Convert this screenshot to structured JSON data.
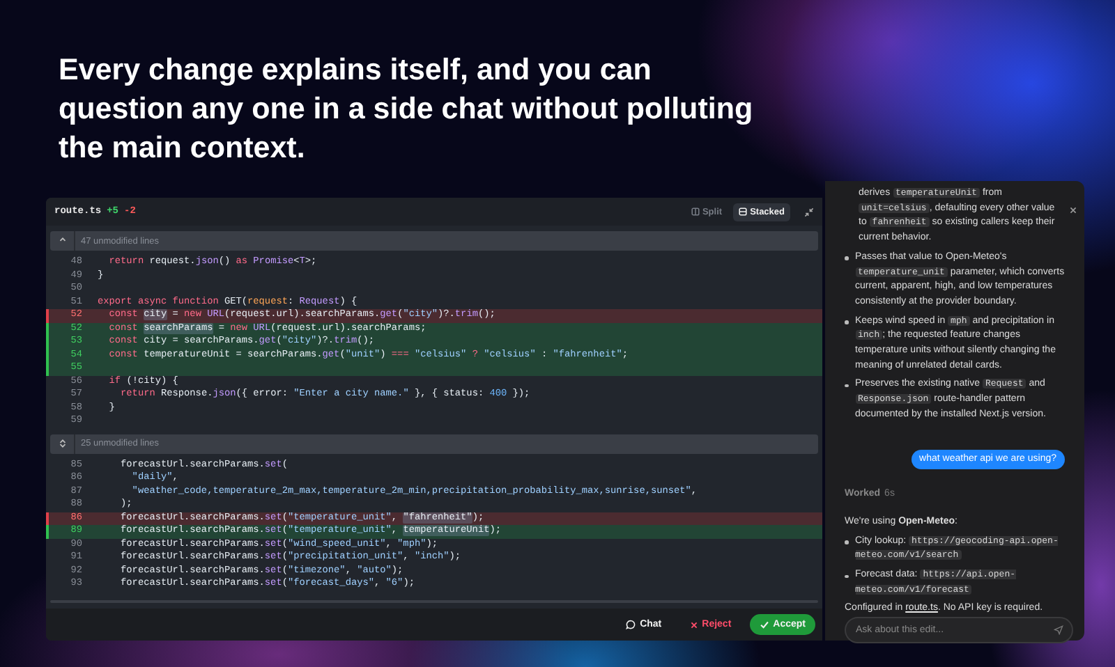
{
  "headline": "Every change explains itself, and you can question any one in a side chat without polluting the main context.",
  "editor": {
    "file": "route.ts",
    "added": "+5",
    "removed": "-2",
    "view_options": [
      {
        "label": "Split",
        "selected": false,
        "kind": "split"
      },
      {
        "label": "Stacked",
        "selected": true,
        "kind": "stacked"
      }
    ],
    "hunks": [
      {
        "collapsed": "47 unmodified lines",
        "lines": [
          {
            "number": "48",
            "kind": "context",
            "tokens": [
              {
                "text": "  return ",
                "kind": "keyword"
              },
              {
                "text": "request.",
                "kind": "plain"
              },
              {
                "text": "json",
                "kind": "function"
              },
              {
                "text": "() ",
                "kind": "plain"
              },
              {
                "text": "as ",
                "kind": "keyword"
              },
              {
                "text": "Promise",
                "kind": "type"
              },
              {
                "text": "<",
                "kind": "plain"
              },
              {
                "text": "T",
                "kind": "type"
              },
              {
                "text": ">;",
                "kind": "plain"
              }
            ]
          },
          {
            "number": "49",
            "kind": "context",
            "tokens": [
              {
                "text": "}",
                "kind": "plain"
              }
            ]
          },
          {
            "number": "50",
            "kind": "context"
          },
          {
            "number": "51",
            "kind": "context",
            "tokens": [
              {
                "text": "export async function ",
                "kind": "keyword"
              },
              {
                "text": "GET(",
                "kind": "plain"
              },
              {
                "text": "request",
                "kind": "param"
              },
              {
                "text": ": ",
                "kind": "plain"
              },
              {
                "text": "Request",
                "kind": "type"
              },
              {
                "text": ") {",
                "kind": "plain"
              }
            ]
          },
          {
            "number": "52",
            "kind": "removed",
            "tokens": [
              {
                "text": "  const ",
                "kind": "keyword"
              },
              {
                "text": "city",
                "kind": "highlight"
              },
              {
                "text": " = ",
                "kind": "plain"
              },
              {
                "text": "new ",
                "kind": "keyword"
              },
              {
                "text": "URL",
                "kind": "function"
              },
              {
                "text": "(request.url).searchParams.",
                "kind": "plain"
              },
              {
                "text": "get",
                "kind": "function"
              },
              {
                "text": "(",
                "kind": "plain"
              },
              {
                "text": "\"city\"",
                "kind": "string"
              },
              {
                "text": ")?.",
                "kind": "plain"
              },
              {
                "text": "trim",
                "kind": "function"
              },
              {
                "text": "();",
                "kind": "plain"
              }
            ]
          },
          {
            "number": "52",
            "kind": "added",
            "tokens": [
              {
                "text": "  const ",
                "kind": "keyword"
              },
              {
                "text": "searchParams",
                "kind": "highlight"
              },
              {
                "text": " = ",
                "kind": "plain"
              },
              {
                "text": "new ",
                "kind": "keyword"
              },
              {
                "text": "URL",
                "kind": "function"
              },
              {
                "text": "(request.url).searchParams;",
                "kind": "plain"
              }
            ]
          },
          {
            "number": "53",
            "kind": "added",
            "tokens": [
              {
                "text": "  const ",
                "kind": "keyword"
              },
              {
                "text": "city = searchParams.",
                "kind": "plain"
              },
              {
                "text": "get",
                "kind": "function"
              },
              {
                "text": "(",
                "kind": "plain"
              },
              {
                "text": "\"city\"",
                "kind": "string"
              },
              {
                "text": ")?.",
                "kind": "plain"
              },
              {
                "text": "trim",
                "kind": "function"
              },
              {
                "text": "();",
                "kind": "plain"
              }
            ]
          },
          {
            "number": "54",
            "kind": "added",
            "tokens": [
              {
                "text": "  const ",
                "kind": "keyword"
              },
              {
                "text": "temperatureUnit = searchParams.",
                "kind": "plain"
              },
              {
                "text": "get",
                "kind": "function"
              },
              {
                "text": "(",
                "kind": "plain"
              },
              {
                "text": "\"unit\"",
                "kind": "string"
              },
              {
                "text": ") ",
                "kind": "plain"
              },
              {
                "text": "=== ",
                "kind": "keyword"
              },
              {
                "text": "\"celsius\" ",
                "kind": "string"
              },
              {
                "text": "? ",
                "kind": "keyword"
              },
              {
                "text": "\"celsius\"",
                "kind": "string"
              },
              {
                "text": " : ",
                "kind": "plain"
              },
              {
                "text": "\"fahrenheit\"",
                "kind": "string"
              },
              {
                "text": ";",
                "kind": "plain"
              }
            ]
          },
          {
            "number": "55",
            "kind": "added"
          },
          {
            "number": "56",
            "kind": "context",
            "tokens": [
              {
                "text": "  if ",
                "kind": "keyword"
              },
              {
                "text": "(!city) {",
                "kind": "plain"
              }
            ]
          },
          {
            "number": "57",
            "kind": "context",
            "tokens": [
              {
                "text": "    return ",
                "kind": "keyword"
              },
              {
                "text": "Response.",
                "kind": "plain"
              },
              {
                "text": "json",
                "kind": "function"
              },
              {
                "text": "({ error: ",
                "kind": "plain"
              },
              {
                "text": "\"Enter a city name.\"",
                "kind": "string"
              },
              {
                "text": " }, { status: ",
                "kind": "plain"
              },
              {
                "text": "400",
                "kind": "number"
              },
              {
                "text": " });",
                "kind": "plain"
              }
            ]
          },
          {
            "number": "58",
            "kind": "context",
            "tokens": [
              {
                "text": "  }",
                "kind": "plain"
              }
            ]
          },
          {
            "number": "59",
            "kind": "context"
          }
        ]
      },
      {
        "collapsed": "25 unmodified lines",
        "lines": [
          {
            "number": "85",
            "kind": "context",
            "tokens": [
              {
                "text": "    forecastUrl.searchParams.",
                "kind": "plain"
              },
              {
                "text": "set",
                "kind": "function"
              },
              {
                "text": "(",
                "kind": "plain"
              }
            ]
          },
          {
            "number": "86",
            "kind": "context",
            "tokens": [
              {
                "text": "      \"daily\"",
                "kind": "string"
              },
              {
                "text": ",",
                "kind": "plain"
              }
            ]
          },
          {
            "number": "87",
            "kind": "context",
            "tokens": [
              {
                "text": "      \"weather_code,temperature_2m_max,temperature_2m_min,precipitation_probability_max,sunrise,sunset\"",
                "kind": "string"
              },
              {
                "text": ",",
                "kind": "plain"
              }
            ]
          },
          {
            "number": "88",
            "kind": "context",
            "tokens": [
              {
                "text": "    );",
                "kind": "plain"
              }
            ]
          },
          {
            "number": "86",
            "kind": "removed",
            "tokens": [
              {
                "text": "    forecastUrl.searchParams.",
                "kind": "plain"
              },
              {
                "text": "set",
                "kind": "function"
              },
              {
                "text": "(",
                "kind": "plain"
              },
              {
                "text": "\"temperature_unit\"",
                "kind": "string"
              },
              {
                "text": ", ",
                "kind": "plain"
              },
              {
                "text": "\"fahrenheit\"",
                "kind": "highlight"
              },
              {
                "text": ");",
                "kind": "plain"
              }
            ]
          },
          {
            "number": "89",
            "kind": "added",
            "tokens": [
              {
                "text": "    forecastUrl.searchParams.",
                "kind": "plain"
              },
              {
                "text": "set",
                "kind": "function"
              },
              {
                "text": "(",
                "kind": "plain"
              },
              {
                "text": "\"temperature_unit\"",
                "kind": "string"
              },
              {
                "text": ", ",
                "kind": "plain"
              },
              {
                "text": "temperatureUnit",
                "kind": "highlight"
              },
              {
                "text": ");",
                "kind": "plain"
              }
            ]
          },
          {
            "number": "90",
            "kind": "context",
            "tokens": [
              {
                "text": "    forecastUrl.searchParams.",
                "kind": "plain"
              },
              {
                "text": "set",
                "kind": "function"
              },
              {
                "text": "(",
                "kind": "plain"
              },
              {
                "text": "\"wind_speed_unit\"",
                "kind": "string"
              },
              {
                "text": ", ",
                "kind": "plain"
              },
              {
                "text": "\"mph\"",
                "kind": "string"
              },
              {
                "text": ");",
                "kind": "plain"
              }
            ]
          },
          {
            "number": "91",
            "kind": "context",
            "tokens": [
              {
                "text": "    forecastUrl.searchParams.",
                "kind": "plain"
              },
              {
                "text": "set",
                "kind": "function"
              },
              {
                "text": "(",
                "kind": "plain"
              },
              {
                "text": "\"precipitation_unit\"",
                "kind": "string"
              },
              {
                "text": ", ",
                "kind": "plain"
              },
              {
                "text": "\"inch\"",
                "kind": "string"
              },
              {
                "text": ");",
                "kind": "plain"
              }
            ]
          },
          {
            "number": "92",
            "kind": "context",
            "tokens": [
              {
                "text": "    forecastUrl.searchParams.",
                "kind": "plain"
              },
              {
                "text": "set",
                "kind": "function"
              },
              {
                "text": "(",
                "kind": "plain"
              },
              {
                "text": "\"timezone\"",
                "kind": "string"
              },
              {
                "text": ", ",
                "kind": "plain"
              },
              {
                "text": "\"auto\"",
                "kind": "string"
              },
              {
                "text": ");",
                "kind": "plain"
              }
            ]
          },
          {
            "number": "93",
            "kind": "context",
            "tokens": [
              {
                "text": "    forecastUrl.searchParams.",
                "kind": "plain"
              },
              {
                "text": "set",
                "kind": "function"
              },
              {
                "text": "(",
                "kind": "plain"
              },
              {
                "text": "\"forecast_days\"",
                "kind": "string"
              },
              {
                "text": ", ",
                "kind": "plain"
              },
              {
                "text": "\"6\"",
                "kind": "string"
              },
              {
                "text": ");",
                "kind": "plain"
              }
            ]
          }
        ]
      }
    ],
    "actions": [
      {
        "label": "Chat",
        "kind": "chat"
      },
      {
        "label": "Reject",
        "kind": "reject"
      },
      {
        "label": "Accept",
        "kind": "accept"
      }
    ]
  },
  "chat": {
    "intro": [
      {
        "text": "derives ",
        "kind": "text"
      },
      {
        "text": "temperatureUnit",
        "kind": "code"
      },
      {
        "text": " from ",
        "kind": "text"
      },
      {
        "text": "unit=celsius",
        "kind": "code"
      },
      {
        "text": ", defaulting every other value to ",
        "kind": "text"
      },
      {
        "text": "fahrenheit",
        "kind": "code"
      },
      {
        "text": " so existing callers keep their current behavior.",
        "kind": "text"
      }
    ],
    "bullets": [
      [
        {
          "text": "Passes that value to Open-Meteo's ",
          "kind": "text"
        },
        {
          "text": "temperature_unit",
          "kind": "code"
        },
        {
          "text": " parameter, which converts current, apparent, high, and low temperatures consistently at the provider boundary.",
          "kind": "text"
        }
      ],
      [
        {
          "text": "Keeps wind speed in ",
          "kind": "text"
        },
        {
          "text": "mph",
          "kind": "code"
        },
        {
          "text": " and precipitation in ",
          "kind": "text"
        },
        {
          "text": "inch",
          "kind": "code"
        },
        {
          "text": "; the requested feature changes temperature units without silently changing the meaning of unrelated detail cards.",
          "kind": "text"
        }
      ],
      [
        {
          "text": "Preserves the existing native ",
          "kind": "text"
        },
        {
          "text": "Request",
          "kind": "code"
        },
        {
          "text": " and ",
          "kind": "text"
        },
        {
          "text": "Response.json",
          "kind": "code"
        },
        {
          "text": " route-handler pattern documented by the installed Next.js version.",
          "kind": "text"
        }
      ]
    ],
    "user_message": "what weather api we are using?",
    "worked": "Worked",
    "worked_time": "6s",
    "reply_heading": "We're using **Open-Meteo**:",
    "reply_bullets": [
      [
        {
          "text": "City lookup: ",
          "kind": "text"
        },
        {
          "text": "https://geocoding-api.open-meteo.com/v1/search",
          "kind": "code"
        }
      ],
      [
        {
          "text": "Forecast data: ",
          "kind": "text"
        },
        {
          "text": "https://api.open-meteo.com/v1/forecast",
          "kind": "code"
        }
      ]
    ],
    "reply_footer": [
      {
        "text": "Configured in ",
        "kind": "text"
      },
      {
        "text": "route.ts",
        "kind": "link"
      },
      {
        "text": ". No API key is required.",
        "kind": "text"
      }
    ],
    "input_placeholder": "Ask about this edit..."
  }
}
